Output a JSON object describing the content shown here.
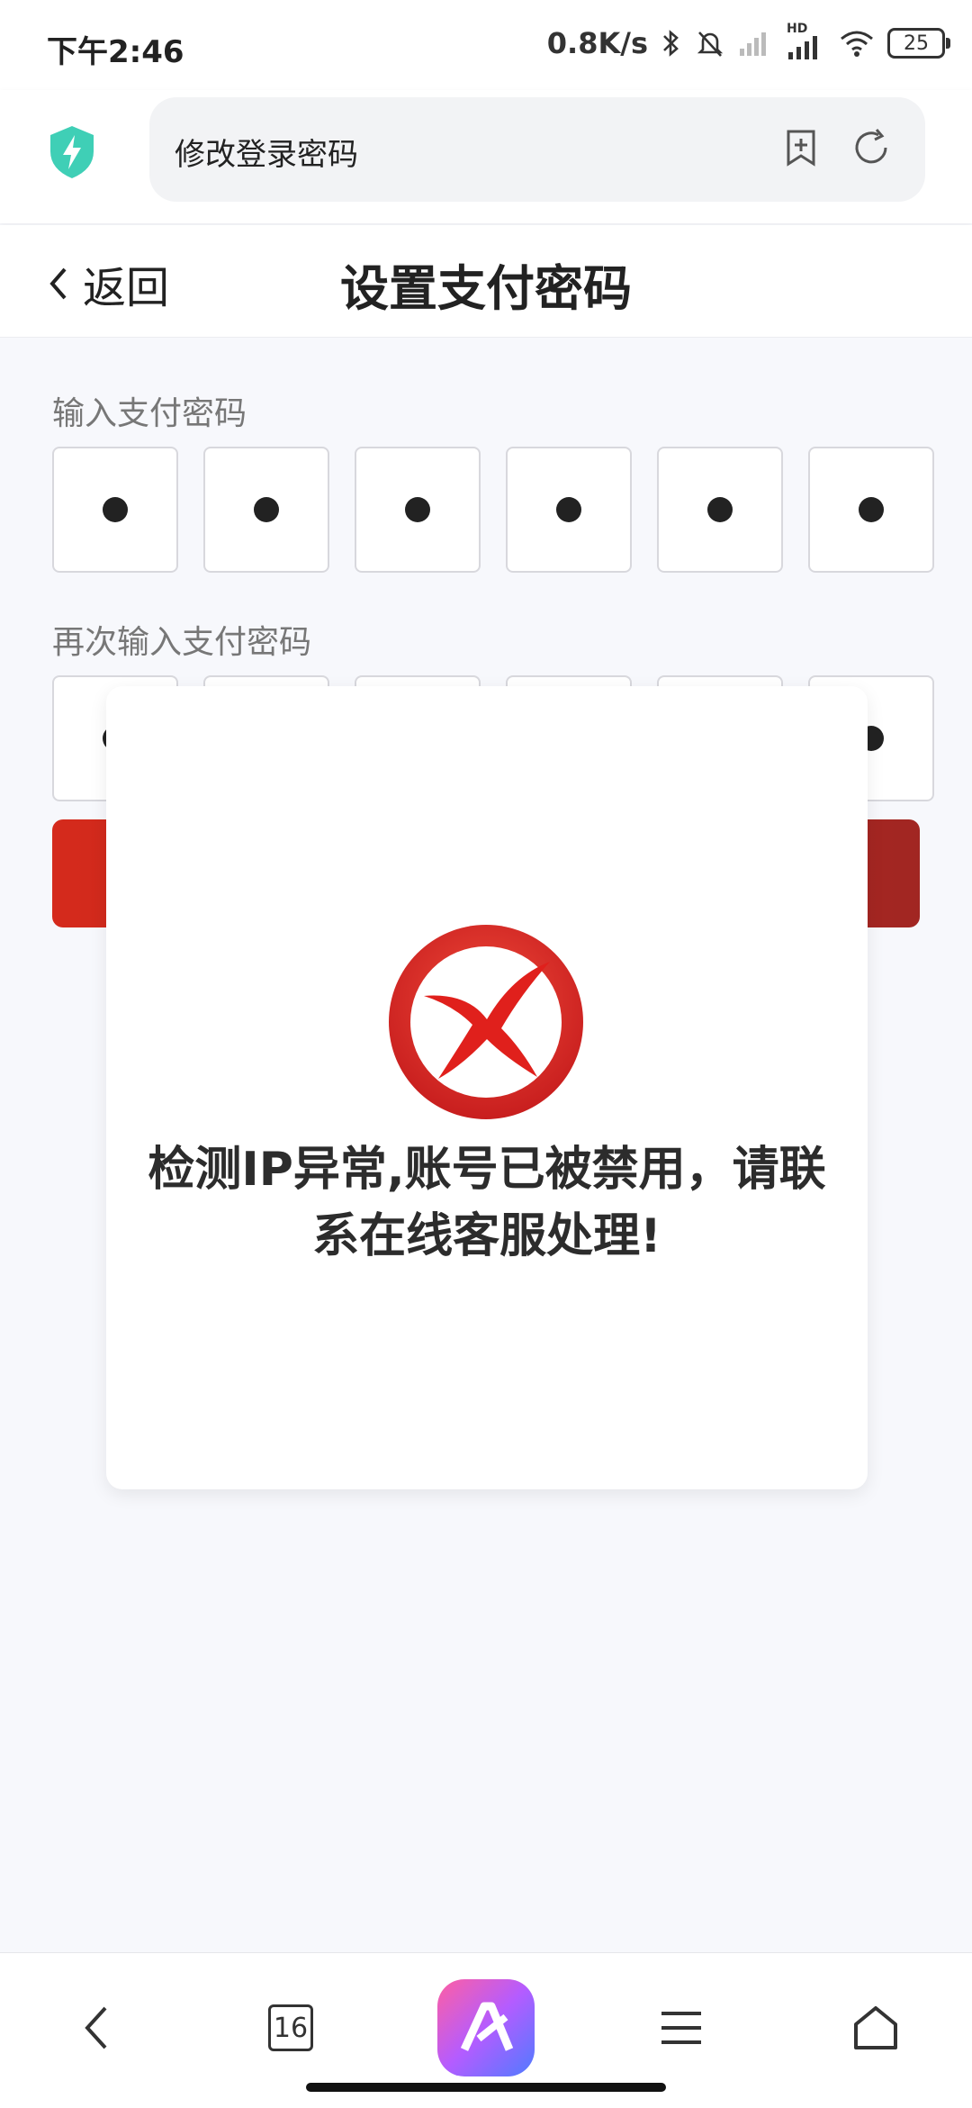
{
  "status_bar": {
    "time": "下午2:46",
    "network_speed": "0.8K/s",
    "hd_label": "HD",
    "battery": "25"
  },
  "browser": {
    "url_text": "修改登录密码"
  },
  "header": {
    "back_label": "返回",
    "title": "设置支付密码"
  },
  "form": {
    "pin_label": "输入支付密码",
    "confirm_label": "再次输入支付密码",
    "pin_digits_entered": 6,
    "confirm_digits_entered": 6
  },
  "modal": {
    "message": "检测IP异常,账号已被禁用，请联系在线客服处理!"
  },
  "bottom_nav": {
    "tab_count": "16"
  },
  "colors": {
    "accent_red": "#d52a1c",
    "shield_teal": "#3fcfb6"
  }
}
